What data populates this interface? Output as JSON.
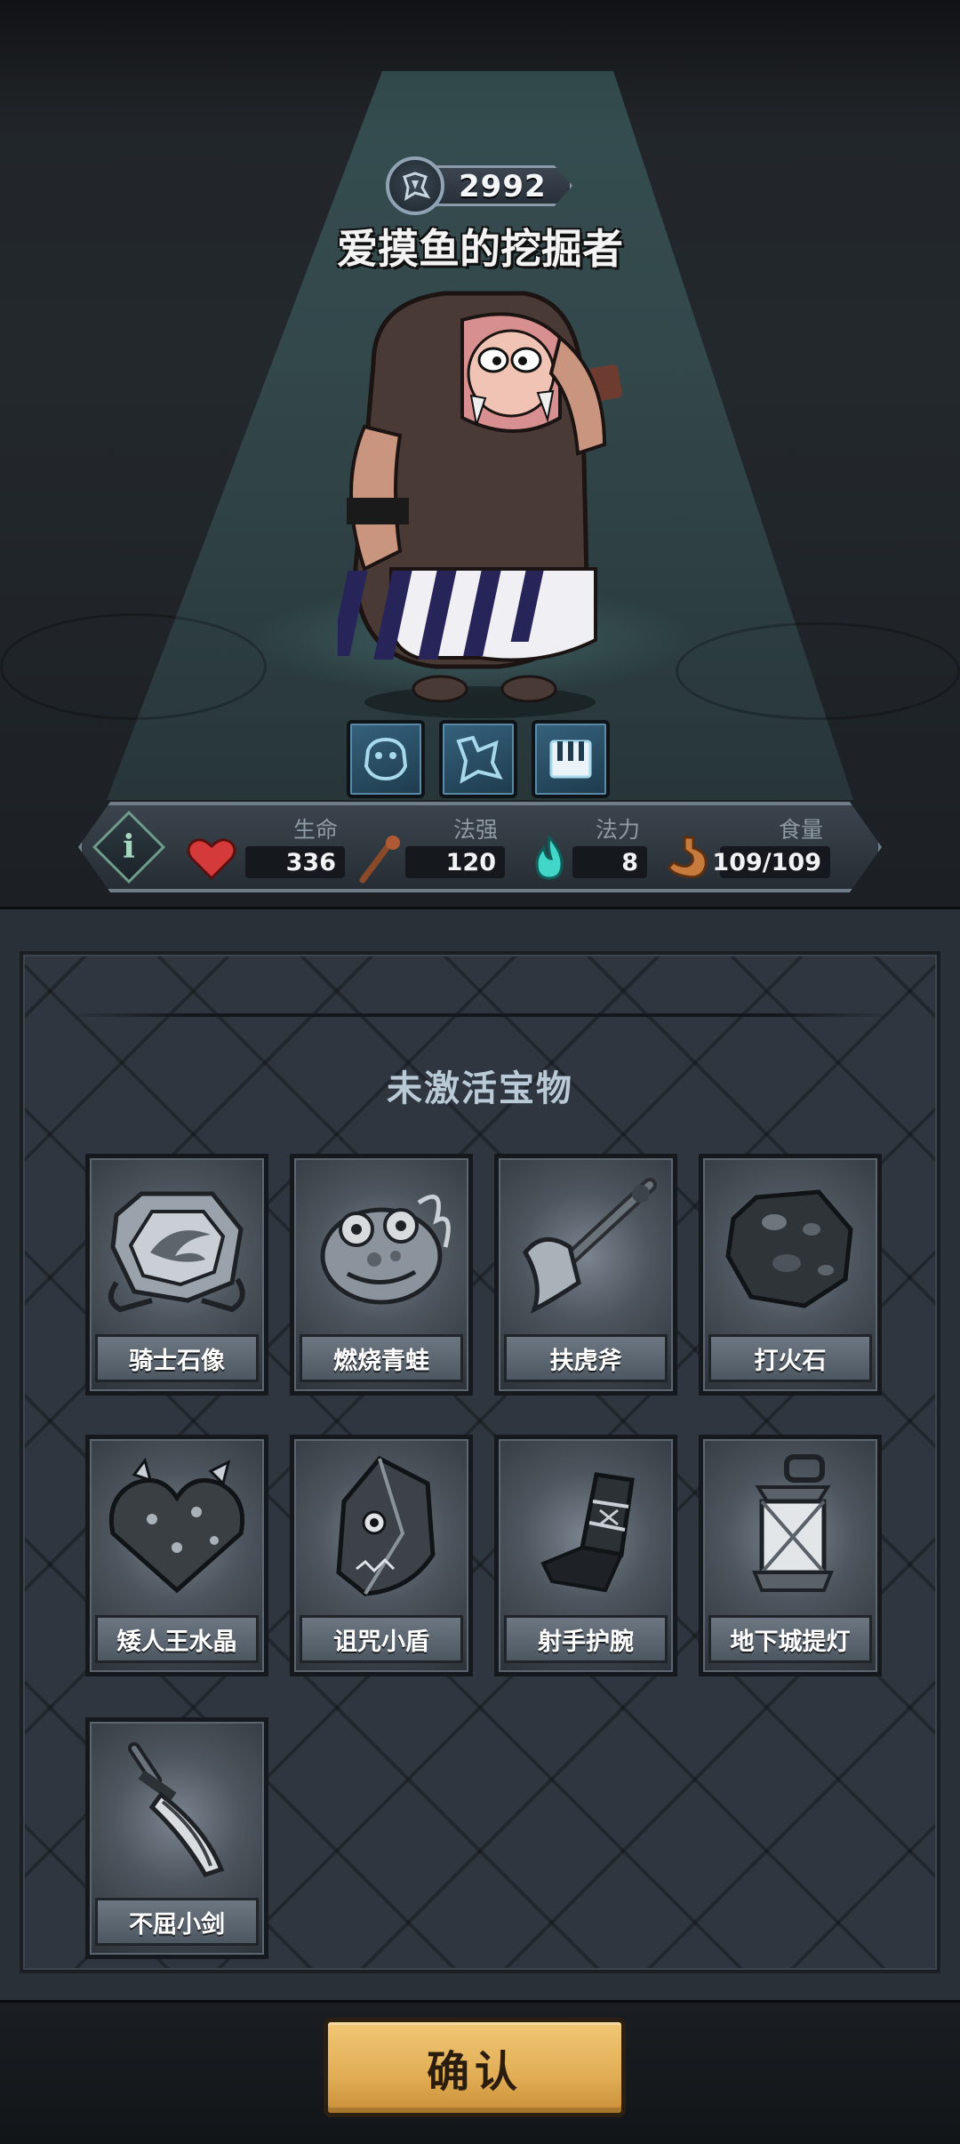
{
  "hero": {
    "score": "2992",
    "name": "爱摸鱼的挖掘者"
  },
  "skills": [
    {
      "icon": "beast-head-icon"
    },
    {
      "icon": "map-rune-icon"
    },
    {
      "icon": "piano-keys-icon"
    }
  ],
  "stats": [
    {
      "label": "生命",
      "value": "336",
      "icon": "heart-icon"
    },
    {
      "label": "法强",
      "value": "120",
      "icon": "staff-icon"
    },
    {
      "label": "法力",
      "value": "8",
      "icon": "blue-flame-icon"
    },
    {
      "label": "食量",
      "value": "109/109",
      "icon": "stomach-icon"
    }
  ],
  "treasures": {
    "title": "未激活宝物",
    "items": [
      {
        "name": "骑士石像",
        "icon": "knight-statue-icon"
      },
      {
        "name": "燃烧青蛙",
        "icon": "burning-frog-icon"
      },
      {
        "name": "扶虎斧",
        "icon": "axe-icon"
      },
      {
        "name": "打火石",
        "icon": "flint-stone-icon"
      },
      {
        "name": "矮人王水晶",
        "icon": "dwarf-crystal-icon"
      },
      {
        "name": "诅咒小盾",
        "icon": "cursed-shield-icon"
      },
      {
        "name": "射手护腕",
        "icon": "archer-bracer-icon"
      },
      {
        "name": "地下城提灯",
        "icon": "lantern-icon"
      },
      {
        "name": "不屈小剑",
        "icon": "short-sword-icon"
      }
    ]
  },
  "footer": {
    "confirm_label": "确认"
  }
}
